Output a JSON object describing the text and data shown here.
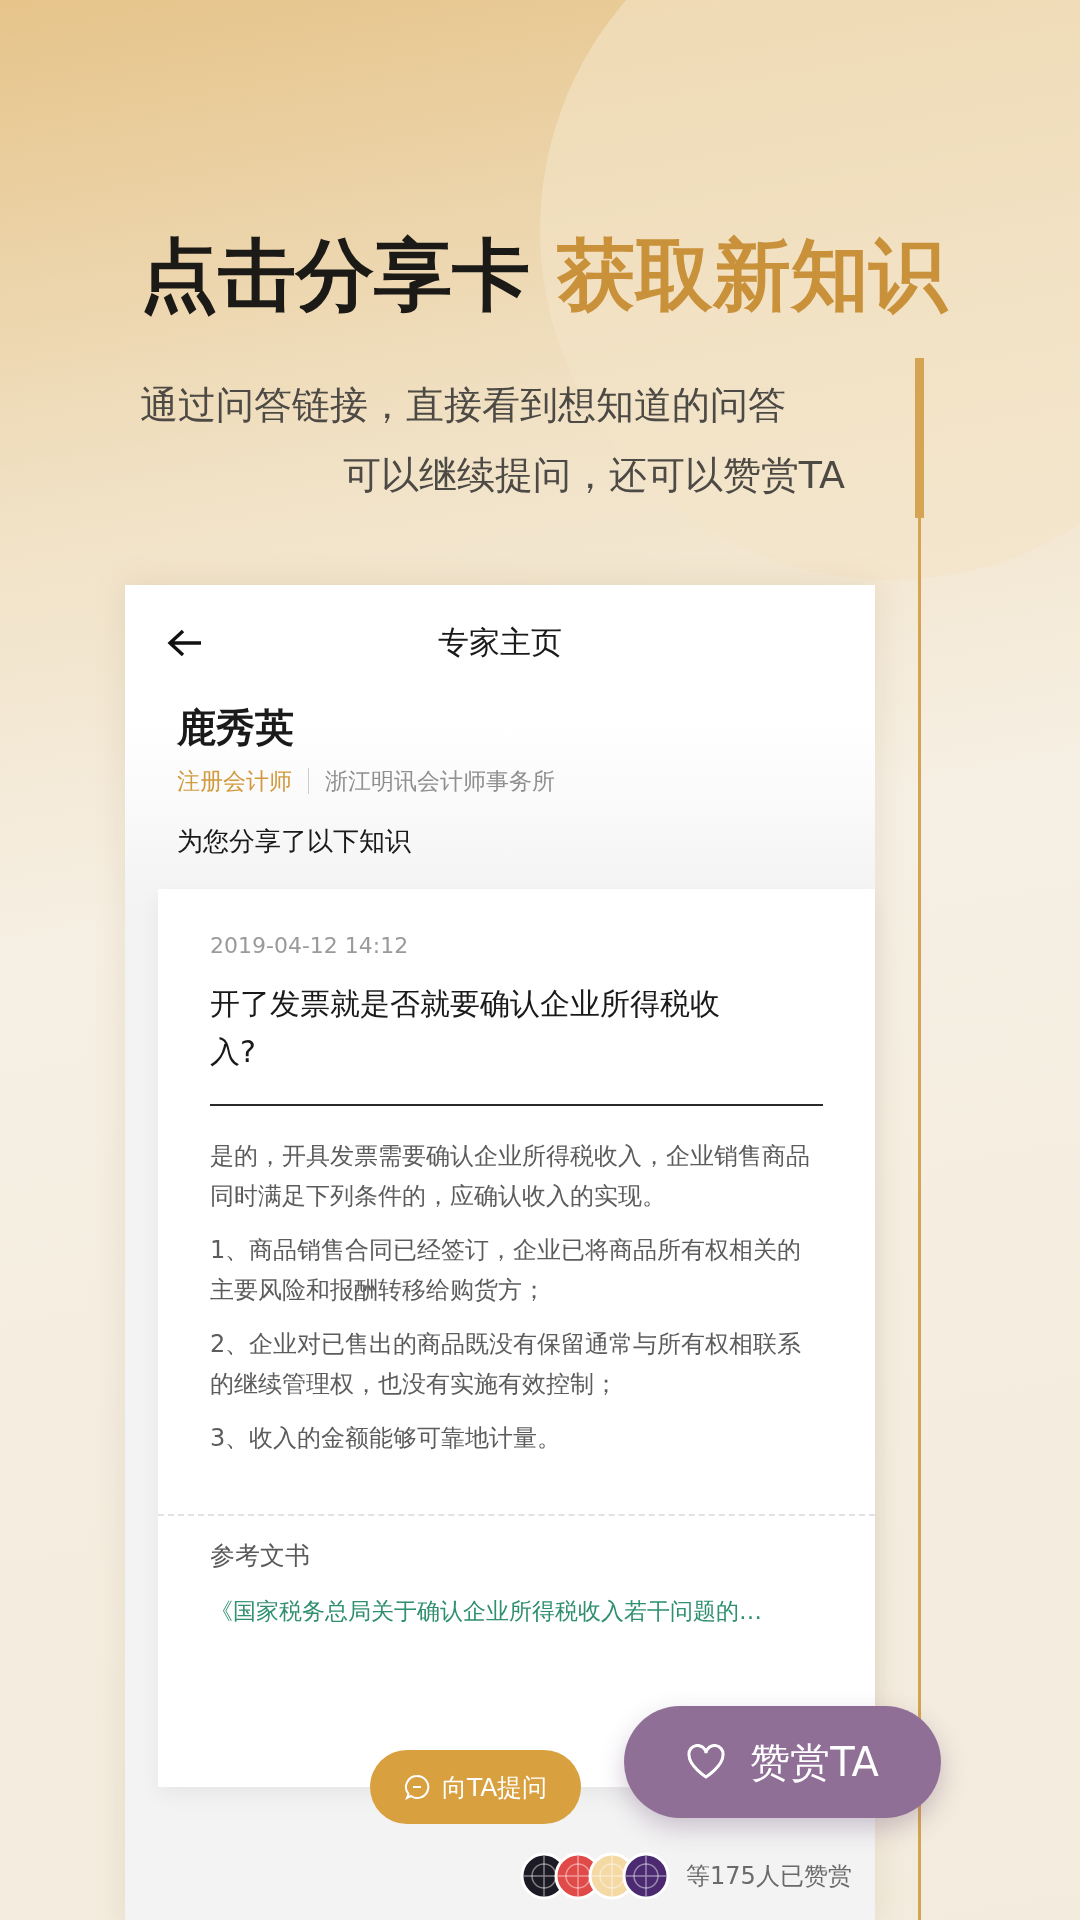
{
  "headline": {
    "lead": "点击分享卡",
    "accent": "获取新知识"
  },
  "subtitle": [
    "通过问答链接，直接看到想知道的问答",
    "可以继续提问，还可以赞赏TA"
  ],
  "screen": {
    "title": "专家主页",
    "expert": {
      "name": "鹿秀英",
      "title": "注册会计师",
      "firm": "浙江明讯会计师事务所"
    },
    "intro": "为您分享了以下知识",
    "answer": {
      "date": "2019-04-12 14:12",
      "question": "开了发票就是否就要确认企业所得税收入?",
      "paragraphs": [
        "是的，开具发票需要确认企业所得税收入，企业销售商品同时满足下列条件的，应确认收入的实现。",
        "1、商品销售合同已经签订，企业已将商品所有权相关的主要风险和报酬转移给购货方；",
        "2、企业对已售出的商品既没有保留通常与所有权相联系的继续管理权，也没有实施有效控制；",
        "3、收入的金额能够可靠地计量。"
      ],
      "reference_label": "参考文书",
      "reference_link": "《国家税务总局关于确认企业所得税收入若干问题的…"
    },
    "ask_button": "向TA提问",
    "reward_button": "赞赏TA",
    "supporters": [
      {
        "color": "#1c1a24"
      },
      {
        "color": "#e04a48"
      },
      {
        "color": "#f4d9a4"
      },
      {
        "color": "#4b2a72"
      }
    ],
    "supporters_text": "等175人已赞赏"
  }
}
